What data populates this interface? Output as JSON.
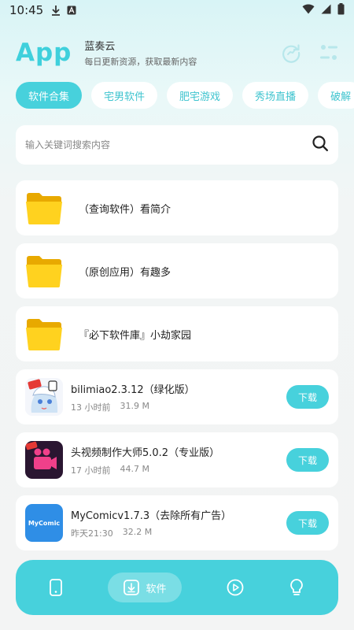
{
  "status_bar": {
    "time": "10:45"
  },
  "header": {
    "logo": "App",
    "name": "蓝奏云",
    "subtitle": "每日更新资源，获取最新内容"
  },
  "tabs": [
    {
      "label": "软件合集"
    },
    {
      "label": "宅男软件"
    },
    {
      "label": "肥宅游戏"
    },
    {
      "label": "秀场直播"
    },
    {
      "label": "破解"
    }
  ],
  "search": {
    "placeholder": "输入关键词搜索内容"
  },
  "folders": [
    {
      "title": "（查询软件）看简介",
      "icon": "folder-icon"
    },
    {
      "title": "（原创应用）有趣多",
      "icon": "folder-icon"
    },
    {
      "title": "『必下软件庫』小劫家园",
      "icon": "folder-icon"
    }
  ],
  "apps": [
    {
      "title": "bilimiao2.3.12（绿化版）",
      "time": "13 小时前",
      "size": "31.9 M",
      "button": "下载"
    },
    {
      "title": "头视频制作大师5.0.2（专业版）",
      "time": "17 小时前",
      "size": "44.7 M",
      "button": "下载"
    },
    {
      "title": "MyComicv1.7.3（去除所有广告）",
      "time": "昨天21:30",
      "size": "32.2 M",
      "button": "下载",
      "icon_text": "MyComic"
    }
  ],
  "bottom_nav": {
    "active_label": "软件"
  },
  "colors": {
    "accent": "#47d1dc",
    "logo": "#3fd0dc"
  }
}
